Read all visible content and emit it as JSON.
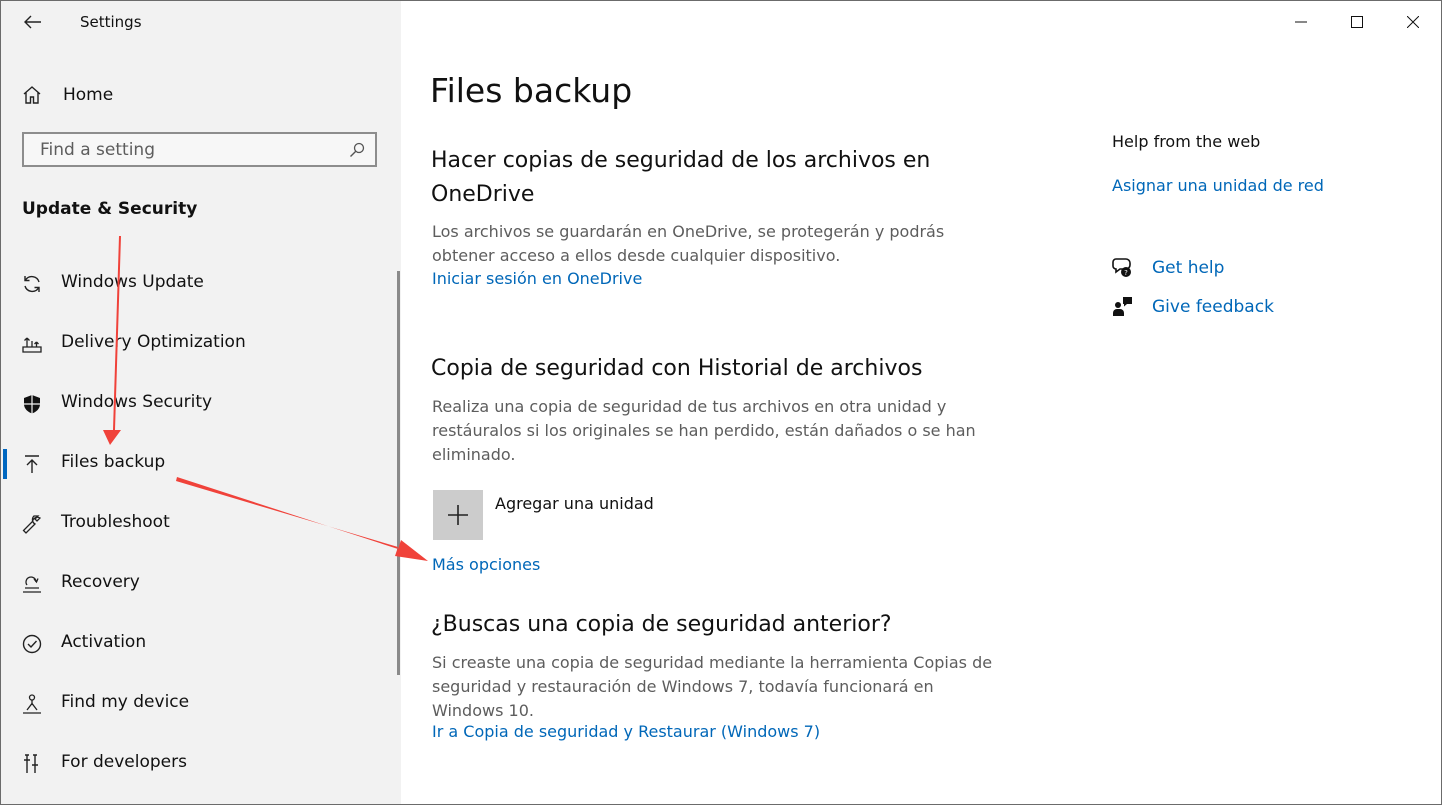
{
  "window": {
    "app_title": "Settings"
  },
  "sidebar": {
    "home_label": "Home",
    "search_placeholder": "Find a setting",
    "section_title": "Update & Security",
    "items": [
      {
        "label": "Windows Update",
        "icon": "sync-icon"
      },
      {
        "label": "Delivery Optimization",
        "icon": "delivery-optimization-icon"
      },
      {
        "label": "Windows Security",
        "icon": "shield-icon"
      },
      {
        "label": "Files backup",
        "icon": "upload-arrow-icon",
        "active": true
      },
      {
        "label": "Troubleshoot",
        "icon": "wrench-icon"
      },
      {
        "label": "Recovery",
        "icon": "recovery-icon"
      },
      {
        "label": "Activation",
        "icon": "check-circle-icon"
      },
      {
        "label": "Find my device",
        "icon": "person-pin-icon"
      },
      {
        "label": "For developers",
        "icon": "developer-tools-icon"
      }
    ]
  },
  "main": {
    "page_title": "Files backup",
    "onedrive": {
      "heading": "Hacer copias de seguridad de los archivos en OneDrive",
      "description": "Los archivos se guardarán en OneDrive, se protegerán y podrás obtener acceso a ellos desde cualquier dispositivo.",
      "link": "Iniciar sesión en OneDrive"
    },
    "file_history": {
      "heading": "Copia de seguridad con Historial de archivos",
      "description": "Realiza una copia de seguridad de tus archivos en otra unidad y restáuralos si los originales se han perdido, están dañados o se han eliminado.",
      "add_drive_label": "Agregar una unidad",
      "more_options_link": "Más opciones"
    },
    "older_backup": {
      "heading": "¿Buscas una copia de seguridad anterior?",
      "description": "Si creaste una copia de seguridad mediante la herramienta Copias de seguridad y restauración de Windows 7, todavía funcionará en Windows 10.",
      "link": "Ir a Copia de seguridad y Restaurar (Windows 7)"
    }
  },
  "right_panel": {
    "help_heading": "Help from the web",
    "help_link": "Asignar una unidad de red",
    "get_help": "Get help",
    "give_feedback": "Give feedback"
  },
  "colors": {
    "accent": "#0067b8",
    "sidebar_bg": "#f2f2f2",
    "annotation_arrow": "#f0423a"
  }
}
